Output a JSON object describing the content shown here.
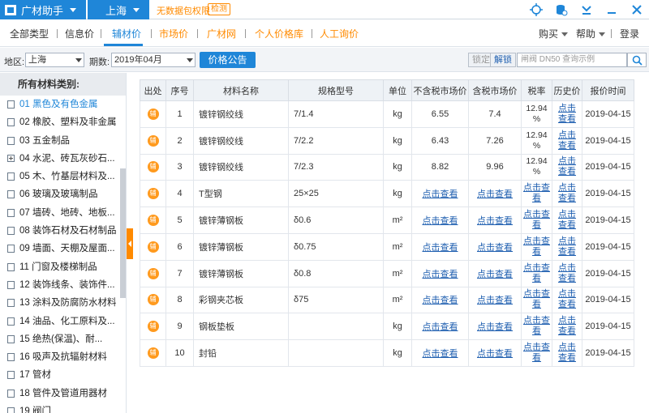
{
  "titlebar": {
    "app_name": "广材助手",
    "city": "上海",
    "no_data_text": "无数据包权限",
    "detect_label": "检测",
    "icons": [
      "target-icon",
      "database-icon",
      "download-icon",
      "minimize-icon",
      "close-icon"
    ]
  },
  "nav": {
    "items": [
      "全部类型",
      "信息价",
      "辅材价",
      "市场价",
      "广材网",
      "个人价格库",
      "人工询价"
    ],
    "active": "辅材价",
    "right": {
      "buy": "购买",
      "help": "帮助",
      "login": "登录"
    }
  },
  "filter": {
    "region_label": "地区:",
    "region_value": "上海",
    "period_label": "期数:",
    "period_value": "2019年04月",
    "price_notice_button": "价格公告",
    "lock_label": "锁定",
    "unlock_label": "解锁",
    "search_placeholder": "闸阀 DN50 查询示例"
  },
  "sidebar": {
    "header": "所有材料类别:",
    "items": [
      {
        "label": "01 黑色及有色金属",
        "icon": "doc"
      },
      {
        "label": "02 橡胶、塑料及非金属",
        "icon": "doc"
      },
      {
        "label": "03 五金制品",
        "icon": "doc"
      },
      {
        "label": "04 水泥、砖瓦灰砂石...",
        "icon": "plus"
      },
      {
        "label": "05 木、竹基层材料及...",
        "icon": "doc"
      },
      {
        "label": "06 玻璃及玻璃制品",
        "icon": "doc"
      },
      {
        "label": "07 墙砖、地砖、地板...",
        "icon": "doc"
      },
      {
        "label": "08 装饰石材及石材制品",
        "icon": "doc"
      },
      {
        "label": "09 墙面、天棚及屋面...",
        "icon": "doc"
      },
      {
        "label": "11 门窗及楼梯制品",
        "icon": "doc"
      },
      {
        "label": "12 装饰线条、装饰件...",
        "icon": "doc"
      },
      {
        "label": "13 涂料及防腐防水材料",
        "icon": "doc"
      },
      {
        "label": "14 油品、化工原料及...",
        "icon": "doc"
      },
      {
        "label": "15 绝热(保温)、耐...",
        "icon": "doc"
      },
      {
        "label": "16 吸声及抗辐射材料",
        "icon": "doc"
      },
      {
        "label": "17 管材",
        "icon": "doc"
      },
      {
        "label": "18 管件及管道用器材",
        "icon": "doc"
      },
      {
        "label": "19 阀门",
        "icon": "doc"
      }
    ],
    "active_index": 0
  },
  "table": {
    "headers": [
      "出处",
      "序号",
      "材料名称",
      "规格型号",
      "单位",
      "不含税市场价",
      "含税市场价",
      "税率",
      "历史价",
      "报价时间"
    ],
    "badge": "辅",
    "link_text": "点击查看",
    "rows": [
      {
        "no": "1",
        "name": "镀锌钢绞线",
        "spec": "7/1.4",
        "unit": "kg",
        "price_ex": "6.55",
        "price_inc": "7.4",
        "rate_l1": "12.94",
        "rate_l2": "%",
        "hist_l1": "点击",
        "hist_l2": "查看",
        "date": "2019-04-15"
      },
      {
        "no": "2",
        "name": "镀锌钢绞线",
        "spec": "7/2.2",
        "unit": "kg",
        "price_ex": "6.43",
        "price_inc": "7.26",
        "rate_l1": "12.94",
        "rate_l2": "%",
        "hist_l1": "点击",
        "hist_l2": "查看",
        "date": "2019-04-15"
      },
      {
        "no": "3",
        "name": "镀锌钢绞线",
        "spec": "7/2.3",
        "unit": "kg",
        "price_ex": "8.82",
        "price_inc": "9.96",
        "rate_l1": "12.94",
        "rate_l2": "%",
        "hist_l1": "点击",
        "hist_l2": "查看",
        "date": "2019-04-15"
      },
      {
        "no": "4",
        "name": "T型钢",
        "spec": "25×25",
        "unit": "kg",
        "price_ex": "点击查看",
        "price_inc": "点击查看",
        "rate_l1": "点击查",
        "rate_l2": "看",
        "hist_l1": "点击",
        "hist_l2": "查看",
        "date": "2019-04-15"
      },
      {
        "no": "5",
        "name": "镀锌薄钢板",
        "spec": "δ0.6",
        "unit": "m²",
        "price_ex": "点击查看",
        "price_inc": "点击查看",
        "rate_l1": "点击查",
        "rate_l2": "看",
        "hist_l1": "点击",
        "hist_l2": "查看",
        "date": "2019-04-15"
      },
      {
        "no": "6",
        "name": "镀锌薄钢板",
        "spec": "δ0.75",
        "unit": "m²",
        "price_ex": "点击查看",
        "price_inc": "点击查看",
        "rate_l1": "点击查",
        "rate_l2": "看",
        "hist_l1": "点击",
        "hist_l2": "查看",
        "date": "2019-04-15"
      },
      {
        "no": "7",
        "name": "镀锌薄钢板",
        "spec": "δ0.8",
        "unit": "m²",
        "price_ex": "点击查看",
        "price_inc": "点击查看",
        "rate_l1": "点击查",
        "rate_l2": "看",
        "hist_l1": "点击",
        "hist_l2": "查看",
        "date": "2019-04-15"
      },
      {
        "no": "8",
        "name": "彩钢夹芯板",
        "spec": "δ75",
        "unit": "m²",
        "price_ex": "点击查看",
        "price_inc": "点击查看",
        "rate_l1": "点击查",
        "rate_l2": "看",
        "hist_l1": "点击",
        "hist_l2": "查看",
        "date": "2019-04-15"
      },
      {
        "no": "9",
        "name": "钢板垫板",
        "spec": "",
        "unit": "kg",
        "price_ex": "点击查看",
        "price_inc": "点击查看",
        "rate_l1": "点击查",
        "rate_l2": "看",
        "hist_l1": "点击",
        "hist_l2": "查看",
        "date": "2019-04-15"
      },
      {
        "no": "10",
        "name": "封铅",
        "spec": "",
        "unit": "kg",
        "price_ex": "点击查看",
        "price_inc": "点击查看",
        "rate_l1": "点击查",
        "rate_l2": "看",
        "hist_l1": "点击",
        "hist_l2": "查看",
        "date": "2019-04-15"
      }
    ]
  },
  "colors": {
    "accent": "#1f86d8",
    "orange": "#ff8a00",
    "link": "#1f5fb0"
  }
}
